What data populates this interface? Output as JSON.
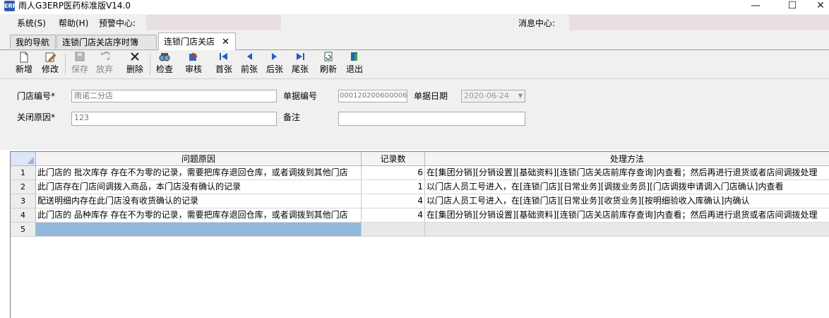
{
  "window": {
    "icon_text": "ERP",
    "title": "雨人G3ERP医药标准版V14.0",
    "controls": {
      "minimize": "—",
      "maximize": "☐",
      "close": "✕"
    }
  },
  "menu": {
    "system": "系统(S)",
    "help": "帮助(H)",
    "warning_center": "预警中心:",
    "message_center": "消息中心:"
  },
  "tabs": [
    {
      "label": "我的导航"
    },
    {
      "label": "连锁门店关店序时簿"
    },
    {
      "label": "连锁门店关店",
      "close": "✕"
    }
  ],
  "toolbar": {
    "new": "新增",
    "edit": "修改",
    "save": "保存",
    "discard": "放弃",
    "delete": "删除",
    "check": "检查",
    "audit": "审核",
    "first": "首张",
    "prev": "前张",
    "next": "后张",
    "last": "尾张",
    "refresh": "刷新",
    "exit": "退出"
  },
  "form": {
    "store_code_label": "门店编号*",
    "store_code_value": "雨诺二分店",
    "bill_no_label": "单据编号",
    "bill_no_value": "000120200600006",
    "bill_date_label": "单据日期",
    "bill_date_value": "2020-06-24",
    "close_reason_label": "关闭原因*",
    "close_reason_value": "123",
    "remark_label": "备注",
    "remark_value": ""
  },
  "grid": {
    "headers": [
      "问题原因",
      "记录数",
      "处理方法"
    ],
    "rows": [
      {
        "num": "1",
        "reason": "此门店的 批次库存 存在不为零的记录，需要把库存退回仓库，或者调拨到其他门店",
        "count": "6",
        "method": "在[集团分销][分销设置][基础资料][连锁门店关店前库存查询]内查看；然后再进行退货或者店间调拨处理"
      },
      {
        "num": "2",
        "reason": "此门店存在门店间调拨入商品，本门店没有确认的记录",
        "count": "1",
        "method": "以门店人员工号进入，在[连锁门店][日常业务][调拨业务员][门店调拨申请调入门店确认]内查看"
      },
      {
        "num": "3",
        "reason": "配送明细内存在此门店没有收货确认的记录",
        "count": "4",
        "method": "以门店人员工号进入，在[连锁门店][日常业务][收货业务][按明细验收入库确认]内确认"
      },
      {
        "num": "4",
        "reason": "此门店的 品种库存 存在不为零的记录，需要把库存退回仓库，或者调拨到其他门店",
        "count": "4",
        "method": "在[集团分销][分销设置][基础资料][连锁门店关店前库存查询]内查看；然后再进行退货或者店间调拨处理"
      },
      {
        "num": "5",
        "reason": "",
        "count": "",
        "method": ""
      }
    ]
  }
}
